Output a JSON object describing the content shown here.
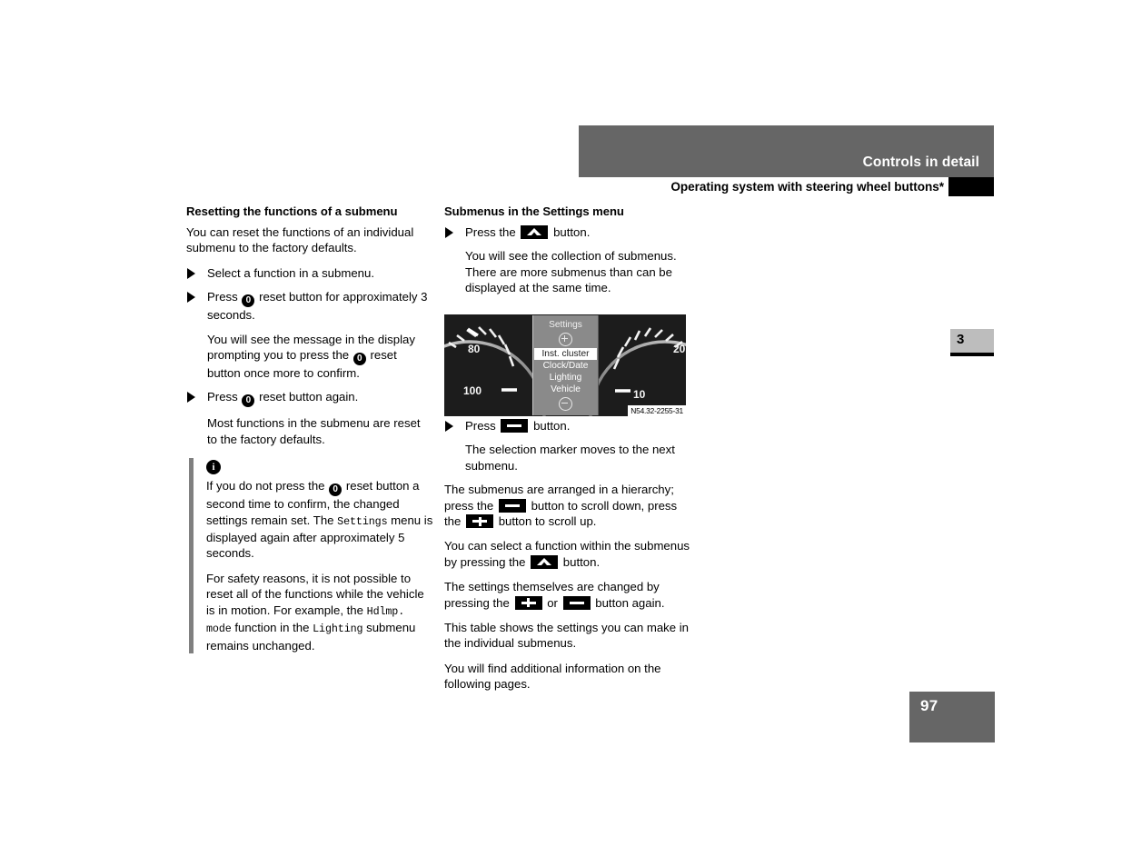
{
  "header": {
    "chapter_title": "Controls in detail",
    "section_title": "Operating system with steering wheel buttons*",
    "chapter_number": "3",
    "page_number": "97"
  },
  "left_column": {
    "heading": "Resetting the functions of a submenu",
    "intro": "You can reset the functions of an individual submenu to the factory defaults.",
    "step1": "Select a function in a submenu.",
    "step2_a": "Press",
    "step2_b": "reset button for approximately 3 seconds.",
    "result1_a": "You will see the message in the display prompting you to press the",
    "result1_b": "reset button once more to confirm.",
    "step3_a": "Press",
    "step3_b": "reset button again.",
    "result2": "Most functions in the submenu are reset to the factory defaults.",
    "note": {
      "icon": "info-icon",
      "p1_a": "If you do not press the",
      "p1_b": "reset button a second time to confirm, the changed settings remain set. The",
      "p1_mono": "Settings",
      "p1_c": "menu is displayed again after approximately 5 seconds.",
      "p2_a": "For safety reasons, it is not possible to reset all of the functions while the vehicle is in motion. For example, the",
      "p2_mono1": "Hdlmp. mode",
      "p2_b": "function in the",
      "p2_mono2": "Lighting",
      "p2_c": "submenu remains unchanged."
    }
  },
  "right_column": {
    "heading": "Submenus in the Settings menu",
    "step1_a": "Press the",
    "step1_b": "button.",
    "result1": "You will see the collection of submenus. There are more submenus than can be displayed at the same time.",
    "step2_a": "Press",
    "step2_b": "button.",
    "result2": "The selection marker moves to the next submenu.",
    "para1_a": "The submenus are arranged in a hierarchy; press the",
    "para1_b": "button to scroll down, press the",
    "para1_c": "button to scroll up.",
    "para2_a": "You can select a function within the submenus by pressing the",
    "para2_b": "button.",
    "para3_a": "The settings themselves are changed by pressing the",
    "para3_b": "or",
    "para3_c": "button again.",
    "para4": "This table shows the settings you can make in the individual submenus.",
    "para5": "You will find additional information on the following pages."
  },
  "figure": {
    "caption": "N54.32-2255-31",
    "left_gauge_labels": [
      "80",
      "100"
    ],
    "right_gauge_labels": [
      "10",
      "20"
    ],
    "display": {
      "title": "Settings",
      "scroll_up_icon": "plus-circle-icon",
      "scroll_down_icon": "minus-circle-icon",
      "items": [
        {
          "label": "Inst. cluster",
          "selected": true
        },
        {
          "label": "Clock/Date",
          "selected": false
        },
        {
          "label": "Lighting",
          "selected": false
        },
        {
          "label": "Vehicle",
          "selected": false
        }
      ]
    }
  },
  "glyphs": {
    "reset_button": "0",
    "info": "i"
  },
  "colors": {
    "header_gray": "#666666",
    "chapter_tab_gray": "#bdbdbd",
    "note_rule_gray": "#808080",
    "cluster_bg": "#1c1c1c",
    "cluster_display_bg": "#8a8a8a"
  }
}
